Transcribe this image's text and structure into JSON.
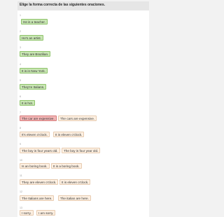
{
  "title": "Elige la forma correcta de las siguientes oraciones.",
  "items": [
    {
      "number": "1",
      "chips": [
        {
          "text": "He is a teacher.",
          "status": "correct"
        }
      ]
    },
    {
      "number": "2",
      "chips": [
        {
          "text": "He's an artist.",
          "status": "correct"
        }
      ]
    },
    {
      "number": "3",
      "chips": [
        {
          "text": "They are Brazilian.",
          "status": "correct"
        }
      ]
    },
    {
      "number": "4",
      "chips": [
        {
          "text": "It is in New York.",
          "status": "correct"
        }
      ]
    },
    {
      "number": "5",
      "chips": [
        {
          "text": "They're Italians.",
          "status": "correct"
        }
      ]
    },
    {
      "number": "6",
      "chips": [
        {
          "text": "It is hot.",
          "status": "correct"
        }
      ]
    },
    {
      "number": "7",
      "chips": [
        {
          "text": "The car are expensive.",
          "status": "wrong"
        },
        {
          "text": "The cars are expensive.",
          "status": "answer"
        }
      ]
    },
    {
      "number": "8",
      "chips": [
        {
          "text": "It's eleven o'clock.",
          "status": "answer"
        },
        {
          "text": "It is eleven o'clock.",
          "status": "answer"
        }
      ]
    },
    {
      "number": "9",
      "chips": [
        {
          "text": "The boy is four years old.",
          "status": "answer"
        },
        {
          "text": "The boy is four year old.",
          "status": "answer"
        }
      ]
    },
    {
      "number": "10",
      "chips": [
        {
          "text": "Is an boring book.",
          "status": "answer"
        },
        {
          "text": "It is a boring book.",
          "status": "answer"
        }
      ]
    },
    {
      "number": "11",
      "chips": [
        {
          "text": "They are eleven o'clock.",
          "status": "answer"
        },
        {
          "text": "It is eleven o'clock.",
          "status": "answer"
        }
      ]
    },
    {
      "number": "12",
      "chips": [
        {
          "text": "The Italians are here.",
          "status": "answer"
        },
        {
          "text": "The italian are here.",
          "status": "answer"
        }
      ]
    },
    {
      "number": "13",
      "chips": [
        {
          "text": "I sorry.",
          "status": "answer"
        },
        {
          "text": "I am sorry.",
          "status": "answer"
        }
      ]
    }
  ],
  "colors": {
    "correct": "#c9e6b4",
    "wrong": "#f3b6b6",
    "answer": "#fdf0e2"
  }
}
